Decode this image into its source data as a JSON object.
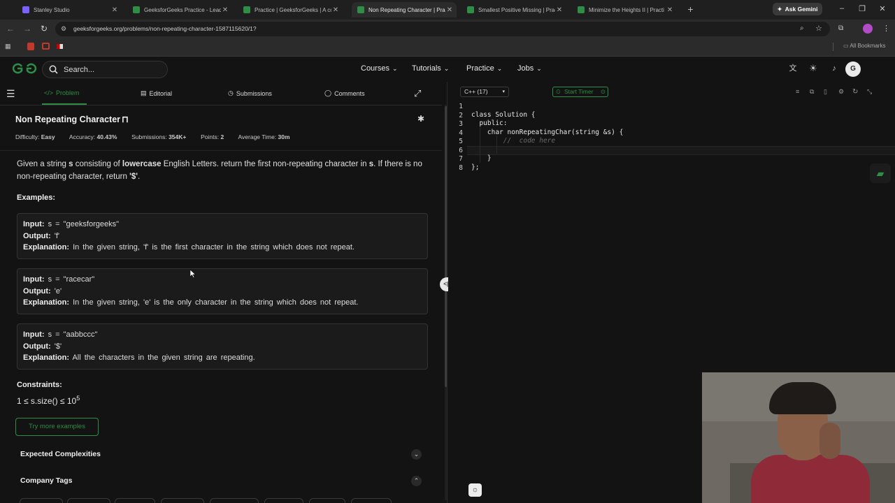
{
  "browser": {
    "tabs": [
      {
        "title": "Stanley Studio",
        "color": "#7b61ff",
        "active": false
      },
      {
        "title": "GeeksforGeeks Practice - Leadi",
        "color": "#2f8d46",
        "active": false
      },
      {
        "title": "Practice | GeeksforGeeks | A co",
        "color": "#2f8d46",
        "active": false
      },
      {
        "title": "Non Repeating Character | Prac",
        "color": "#2f8d46",
        "active": true
      },
      {
        "title": "Smallest Positive Missing | Prac",
        "color": "#2f8d46",
        "active": false
      },
      {
        "title": "Minimize the Heights II | Practi",
        "color": "#2f8d46",
        "active": false
      }
    ],
    "ask_gemini": "Ask Gemini",
    "url": "geeksforgeeks.org/problems/non-repeating-character-1587115620/1?",
    "all_bookmarks": "All Bookmarks"
  },
  "site": {
    "search_placeholder": "Search...",
    "nav": [
      "Courses",
      "Tutorials",
      "Practice",
      "Jobs"
    ],
    "avatar_letter": "G"
  },
  "panel_tabs": {
    "problem": "Problem",
    "editorial": "Editorial",
    "submissions": "Submissions",
    "comments": "Comments"
  },
  "problem": {
    "title": "Non Repeating Character",
    "difficulty_label": "Difficulty:",
    "difficulty": "Easy",
    "accuracy_label": "Accuracy:",
    "accuracy": "40.43%",
    "submissions_label": "Submissions:",
    "submissions": "354K+",
    "points_label": "Points:",
    "points": "2",
    "avg_time_label": "Average Time:",
    "avg_time": "30m",
    "desc_1": "Given a string ",
    "desc_s": "s",
    "desc_2": " consisting of ",
    "desc_lower": "lowercase",
    "desc_3": " English Letters. return the first non-repeating character in ",
    "desc_s2": "s",
    "desc_4": ". If there is no non-repeating character, return ",
    "desc_ret": "'$'",
    "desc_5": ".",
    "examples_heading": "Examples:",
    "examples": [
      {
        "input": "s = \"geeksforgeeks\"",
        "output": "'f'",
        "explanation": "In the given string, 'f' is the first character in the string which does not repeat."
      },
      {
        "input": "s = \"racecar\"",
        "output": "'e'",
        "explanation": "In the given string, 'e' is the only character in the string which does not repeat."
      },
      {
        "input": "s = \"aabbccc\"",
        "output": "'$'",
        "explanation": "All the characters in the given string are repeating."
      }
    ],
    "input_label": "Input:",
    "output_label": "Output:",
    "explanation_label": "Explanation:",
    "constraints_heading": "Constraints:",
    "constraint": "1 ≤ s.size() ≤ 10",
    "constraint_exp": "5",
    "try_more": "Try more examples",
    "expected_complexities": "Expected Complexities",
    "company_tags": "Company Tags"
  },
  "editor": {
    "language": "C++ (17)",
    "start_timer": "Start Timer",
    "line_numbers": [
      "1",
      "2",
      "3",
      "4",
      "5",
      "6",
      "7",
      "8"
    ],
    "code": [
      "class Solution {",
      "  public:",
      "    char nonRepeatingChar(string &s) {",
      "        //  code here",
      "",
      "    }",
      "};"
    ]
  },
  "colors": {
    "accent_green": "#2f8d46",
    "background": "#131313",
    "code_keyword": "#569cd6",
    "comment": "#6a6a6a"
  }
}
